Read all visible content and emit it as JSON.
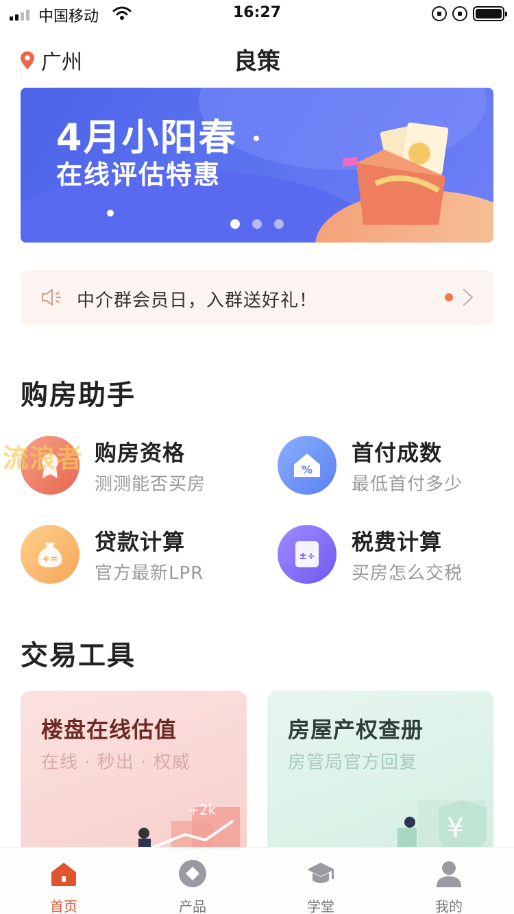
{
  "status_bar": {
    "carrier": "中国移动",
    "time": "16:27"
  },
  "header": {
    "city": "广州",
    "title": "良策"
  },
  "banner": {
    "title": "4月小阳春",
    "subtitle": "在线评估特惠",
    "page_count": 3,
    "active_page": 1
  },
  "notice": {
    "text": "中介群会员日，入群送好礼！"
  },
  "watermark": "流浪者",
  "purchase_helper": {
    "title": "购房助手",
    "items": [
      {
        "title": "购房资格",
        "subtitle": "测测能否买房",
        "icon": "ribbon-badge-icon"
      },
      {
        "title": "首付成数",
        "subtitle": "最低首付多少",
        "icon": "house-percent-icon"
      },
      {
        "title": "贷款计算",
        "subtitle": "官方最新LPR",
        "icon": "money-bag-icon"
      },
      {
        "title": "税费计算",
        "subtitle": "买房怎么交税",
        "icon": "calculator-icon"
      }
    ]
  },
  "trade_tools": {
    "title": "交易工具",
    "cards": [
      {
        "title": "楼盘在线估值",
        "subtitle": "在线 · 秒出 · 权威",
        "art_label": "+2k"
      },
      {
        "title": "房屋产权查册",
        "subtitle": "房管局官方回复",
        "art_label": "¥"
      }
    ]
  },
  "tabbar": {
    "tabs": [
      {
        "label": "首页",
        "icon": "home-icon",
        "active": true
      },
      {
        "label": "产品",
        "icon": "diamond-icon",
        "active": false
      },
      {
        "label": "学堂",
        "icon": "graduation-cap-icon",
        "active": false
      },
      {
        "label": "我的",
        "icon": "user-icon",
        "active": false
      }
    ]
  },
  "colors": {
    "accent": "#e0532f",
    "banner_blue": "#5a72f0",
    "notice_bg": "#fbf4f0"
  }
}
